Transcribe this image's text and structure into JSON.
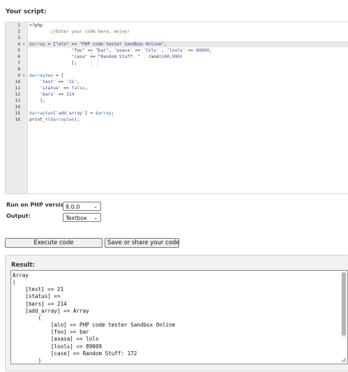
{
  "page": {
    "heading": "Your script:"
  },
  "editor": {
    "line_numbers": [
      "1",
      "2",
      "3",
      "4",
      "5",
      "6",
      "7",
      "8",
      "9",
      "10",
      "11",
      "12",
      "13",
      "14",
      "15",
      "16"
    ],
    "fold_marker_symbol": "▾",
    "code": {
      "l1": "<?php",
      "l2_comment": "//Enter your code here, enjoy!",
      "l4_var": "$array",
      "l4_a": " = [",
      "l4_s1": "\"alo\"",
      "l4_b": " => ",
      "l4_s2": "\"PHP code tester Sandbox Online\"",
      "l4_c": ",",
      "l5_s1": "\"foo\"",
      "l5_a": " => ",
      "l5_s2": "\"bar\"",
      "l5_b": ", ",
      "l5_s3": "'asasa'",
      "l5_c": " => ",
      "l5_s4": "'lols'",
      "l5_d": " , ",
      "l5_s5": "'lools'",
      "l5_e": " => ",
      "l5_n1": "89009",
      "l5_f": ",",
      "l6_s1": "\"case\"",
      "l6_a": " => ",
      "l6_s2": "\"Random Stuff: \"",
      "l6_b": " . ",
      "l6_fn": "rand",
      "l6_c": "(",
      "l6_n1": "100",
      "l6_d": ",",
      "l6_n2": "999",
      "l6_e": ")",
      "l7": "];",
      "l9_var": "$arraytwo",
      "l9_a": " = [",
      "l10_s1": "'test'",
      "l10_a": " => ",
      "l10_s2": "'21'",
      "l10_b": ",",
      "l11_s1": "'status'",
      "l11_a": " => ",
      "l11_kw": "false",
      "l11_b": ",",
      "l12_s1": "'bars'",
      "l12_a": " => ",
      "l12_n1": "214",
      "l13": "];",
      "l15_var1": "$arraytwo",
      "l15_a": "[",
      "l15_s1": "'add_array'",
      "l15_b": "] = ",
      "l15_var2": "$array",
      "l15_c": ";",
      "l16_fn": "print_r",
      "l16_a": "(",
      "l16_var": "$arraytwo",
      "l16_b": ");"
    }
  },
  "options": {
    "php_version_label": "Run on PHP version:",
    "php_version_value": "8.0.0",
    "output_label": "Output:",
    "output_value": "Textbox"
  },
  "buttons": {
    "execute": "Execute code",
    "save": "Save or share your code"
  },
  "result": {
    "label": "Result:",
    "output": "Array\n(\n    [test] => 21\n    [status] => \n    [bars] => 214\n    [add_array] => Array\n        (\n            [alo] => PHP code tester Sandbox Online\n            [foo] => bar\n            [asasa] => lols\n            [lools] => 89009\n            [case] => Random Stuff: 172\n        )\n"
  },
  "colors": {
    "variable": "#3c6d9e",
    "string": "#3d3d8a",
    "number": "#2b4c8a",
    "comment": "#3a8a3a",
    "keyword": "#6d6d6d"
  }
}
